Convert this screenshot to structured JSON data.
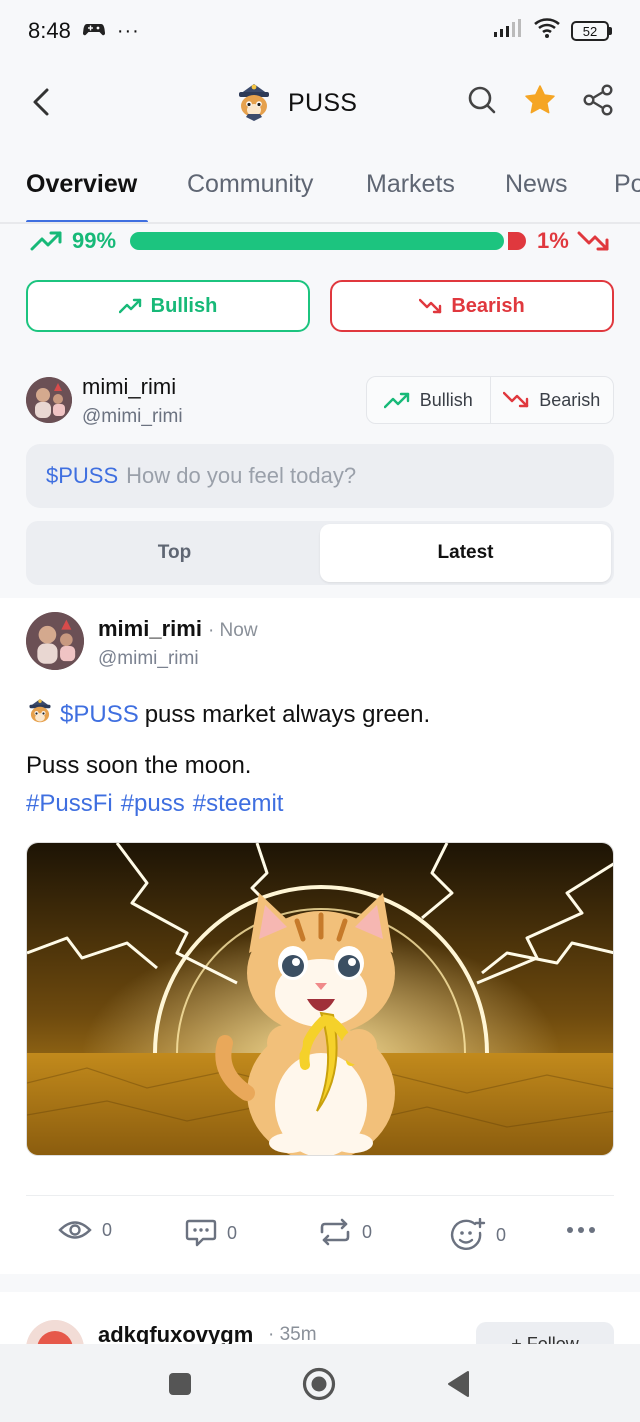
{
  "status_bar": {
    "time": "8:48",
    "more": "···",
    "battery": "52"
  },
  "header": {
    "title": "PUSS"
  },
  "tabs": [
    {
      "label": "Overview"
    },
    {
      "label": "Community"
    },
    {
      "label": "Markets"
    },
    {
      "label": "News"
    },
    {
      "label": "Po"
    }
  ],
  "active_tab": "Overview",
  "sentiment": {
    "bullish_pct": "99%",
    "bearish_pct": "1%",
    "bullish_fraction": 0.99,
    "bearish_fraction": 0.01
  },
  "vote_buttons": {
    "bullish": "Bullish",
    "bearish": "Bearish"
  },
  "compose": {
    "username": "mimi_rimi",
    "handle": "@mimi_rimi",
    "seg_bullish": "Bullish",
    "seg_bearish": "Bearish",
    "ticker": "$PUSS",
    "placeholder": "How do you feel today?"
  },
  "sort": {
    "top": "Top",
    "latest": "Latest",
    "selected": "Latest"
  },
  "post": {
    "username": "mimi_rimi",
    "time": "· Now",
    "handle": "@mimi_rimi",
    "ticker": "$PUSS",
    "line1": "puss market always green.",
    "line2": "Puss soon the moon.",
    "tags": [
      "#PussFi",
      "#puss",
      "#steemit"
    ],
    "stats": {
      "views": "0",
      "comments": "0",
      "reposts": "0",
      "reactions": "0"
    }
  },
  "next_post": {
    "username": "adkqfuxovygm",
    "time": "· 35m",
    "follow_label": "+ Follow"
  },
  "colors": {
    "bull": "#1cc47f",
    "bear": "#e0383e",
    "accent": "#3f6fe0",
    "star": "#f5a524"
  }
}
